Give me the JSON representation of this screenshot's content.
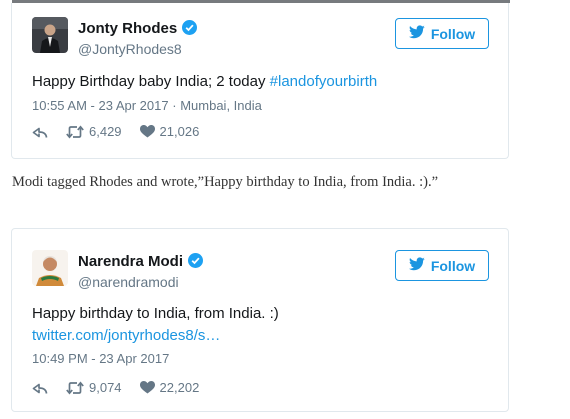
{
  "tweet1": {
    "name": "Jonty Rhodes",
    "handle": "@JontyRhodes8",
    "follow_label": "Follow",
    "text": "Happy Birthday baby India; 2 today ",
    "hashtag": "#landofyourbirth",
    "time": "10:55 AM - 23 Apr 2017",
    "separator": "·",
    "location": "Mumbai, India",
    "retweets": "6,429",
    "likes": "21,026"
  },
  "caption": "Modi tagged Rhodes and wrote,”Happy birthday to India, from India. :).”",
  "tweet2": {
    "name": "Narendra Modi",
    "handle": "@narendramodi",
    "follow_label": "Follow",
    "text": "Happy birthday to India, from India. :)",
    "link": "twitter.com/jontyrhodes8/s…",
    "time": "10:49 PM - 23 Apr 2017",
    "retweets": "9,074",
    "likes": "22,202"
  },
  "colors": {
    "accent": "#1b95e0",
    "muted": "#657786",
    "verified": "#1da1f2"
  },
  "icons": [
    "verified-badge-icon",
    "twitter-bird-icon",
    "reply-icon",
    "retweet-icon",
    "like-heart-icon"
  ]
}
